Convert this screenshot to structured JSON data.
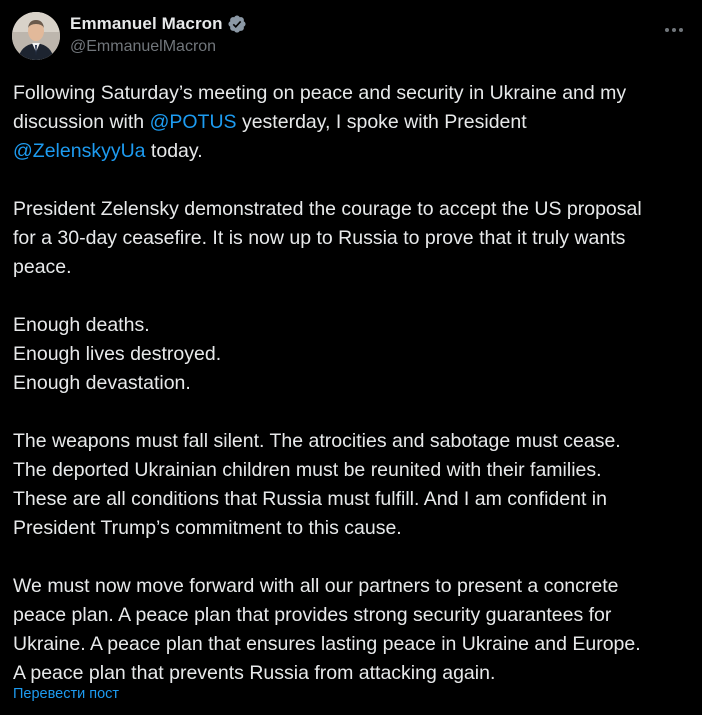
{
  "author": {
    "display_name": "Emmanuel Macron",
    "handle": "@EmmanuelMacron",
    "verified": true,
    "verified_color": "#8b98a5"
  },
  "post": {
    "paragraphs": [
      {
        "lines": [
          [
            {
              "text": "Following Saturday’s meeting on peace and security in Ukraine and my"
            }
          ],
          [
            {
              "text": "discussion with "
            },
            {
              "text": "@POTUS",
              "mention": true
            },
            {
              "text": " yesterday, I spoke with President"
            }
          ],
          [
            {
              "text": "@ZelenskyyUa",
              "mention": true
            },
            {
              "text": " today."
            }
          ]
        ]
      },
      {
        "lines": [
          [
            {
              "text": "President Zelensky demonstrated the courage to accept the US proposal"
            }
          ],
          [
            {
              "text": "for a 30-day ceasefire. It is now up to Russia to prove that it truly wants"
            }
          ],
          [
            {
              "text": "peace."
            }
          ]
        ]
      },
      {
        "lines": [
          [
            {
              "text": "Enough deaths."
            }
          ],
          [
            {
              "text": "Enough lives destroyed."
            }
          ],
          [
            {
              "text": "Enough devastation."
            }
          ]
        ]
      },
      {
        "lines": [
          [
            {
              "text": "The weapons must fall silent. The atrocities and sabotage must cease."
            }
          ],
          [
            {
              "text": "The deported Ukrainian children must be reunited with their families."
            }
          ],
          [
            {
              "text": "These are all conditions that Russia must fulfill. And I am confident in"
            }
          ],
          [
            {
              "text": "President Trump’s commitment to this cause."
            }
          ]
        ]
      },
      {
        "lines": [
          [
            {
              "text": "We must now move forward with all our partners to present a concrete"
            }
          ],
          [
            {
              "text": "peace plan. A peace plan that provides strong security guarantees for"
            }
          ],
          [
            {
              "text": "Ukraine. A peace plan that ensures lasting peace in Ukraine and Europe."
            }
          ],
          [
            {
              "text": "A peace plan that prevents Russia from attacking again."
            }
          ]
        ]
      }
    ],
    "translate_label": "Перевести пост"
  },
  "icons": {
    "more": "more-horizontal-icon",
    "verified": "verified-badge-icon",
    "avatar": "avatar-photo"
  },
  "colors": {
    "background": "#000000",
    "text": "#e7e9ea",
    "secondary": "#71767b",
    "link": "#1d9bf0"
  }
}
